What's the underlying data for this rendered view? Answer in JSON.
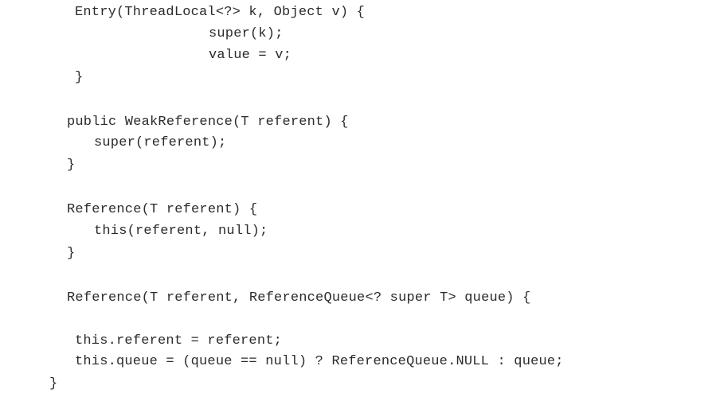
{
  "code": {
    "lines": [
      "Entry(ThreadLocal<?> k, Object v) {",
      "super(k);",
      "value = v;",
      "}",
      "public WeakReference(T referent) {",
      "super(referent);",
      "}",
      "Reference(T referent) {",
      "this(referent, null);",
      "}",
      "Reference(T referent, ReferenceQueue<? super T> queue) {",
      "this.referent = referent;",
      "this.queue = (queue == null) ? ReferenceQueue.NULL : queue;",
      "}"
    ]
  }
}
